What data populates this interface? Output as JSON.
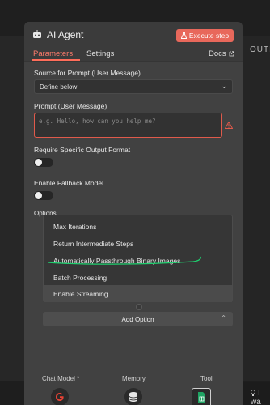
{
  "header": {
    "title": "AI Agent",
    "execute_label": "Execute step",
    "tabs": [
      {
        "label": "Parameters",
        "active": true
      },
      {
        "label": "Settings",
        "active": false
      }
    ],
    "docs_label": "Docs"
  },
  "form": {
    "source_label": "Source for Prompt (User Message)",
    "source_value": "Define below",
    "prompt_label": "Prompt (User Message)",
    "prompt_placeholder": "e.g. Hello, how can you help me?",
    "output_format_label": "Require Specific Output Format",
    "output_format_enabled": false,
    "fallback_label": "Enable Fallback Model",
    "fallback_enabled": false,
    "options_label": "Options"
  },
  "options_dropdown": {
    "items": [
      {
        "label": "Max Iterations"
      },
      {
        "label": "Return Intermediate Steps"
      },
      {
        "label": "Automatically Passthrough Binary Images"
      },
      {
        "label": "Batch Processing"
      },
      {
        "label": "Enable Streaming"
      }
    ],
    "add_option_label": "Add Option"
  },
  "footer": {
    "chat_model_label": "Chat Model *",
    "memory_label": "Memory",
    "tool_label": "Tool"
  },
  "background": {
    "right_label": "OUTPU",
    "right_bottom_text": "I wa"
  },
  "colors": {
    "accent": "#ff6d5a",
    "execute_bg": "#e8685b",
    "error_border": "#e05a4b",
    "annotation": "#1fd06f"
  },
  "icons": [
    "robot-icon",
    "flask-icon",
    "external-link-icon",
    "chevron-down-icon",
    "warning-icon",
    "chevron-up-icon",
    "google-icon",
    "database-icon",
    "sheets-icon",
    "lightbulb-icon"
  ]
}
